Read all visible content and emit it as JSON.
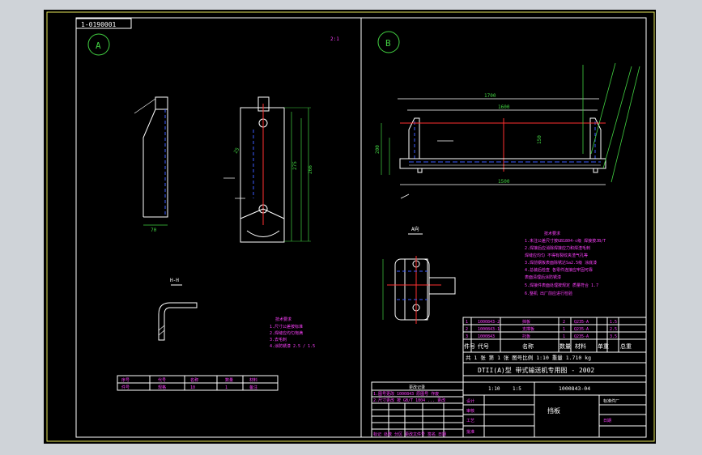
{
  "drawing": {
    "code_box": "1-0190001",
    "view_a_label": "A",
    "view_b_label": "B",
    "scale_note": "2:1",
    "section_label_h": "H-H",
    "section_label_a": "A向",
    "dim_a_width": "70",
    "dim_a_height": "275",
    "dim_a_height2": "266",
    "dim_a_small": "25",
    "dim_b_overall": "1700",
    "dim_b_inner": "1600",
    "dim_b_height": "200",
    "dim_b_mid": "150",
    "dim_b_bottom": "1500"
  },
  "tech_req_a": {
    "title": "技术要求",
    "lines": [
      "1.尺寸公差按标准",
      "2.焊缝应均匀饱满",
      "3.去毛刺",
      "4.涂防锈漆 2.5 / 1.5"
    ]
  },
  "tech_req_b": {
    "title": "技术要求",
    "lines": [
      "1.未注公差尺寸按GB1804-c级 焊接按JB/T",
      "2.焊接后应消除焊接应力和焊渣毛刺",
      "  焊缝应均匀 不得有裂纹夹渣气孔等",
      "3.焊前钢板表面除锈达Sa2.5级 涂底漆",
      "4.总装后检查 各零件连接应牢固可靠",
      "  表面清理后涂防锈漆",
      "5.焊接件表面处理按规定 质量符合 1.7",
      "6.整机 出厂前应进行检验"
    ]
  },
  "small_table": {
    "row1": [
      "序号",
      "代号",
      "名称",
      "数量",
      "材料"
    ],
    "row2": [
      "件号",
      "规格",
      "10",
      "1",
      "备注"
    ]
  },
  "bom": {
    "rows": [
      [
        "1",
        "1000843-2",
        "挡板",
        "2",
        "Q235-A",
        "",
        "1.5"
      ],
      [
        "2",
        "1000843-1",
        "支撑板",
        "1",
        "Q235-A",
        "",
        "2.5"
      ],
      [
        "3",
        "1000843",
        "托板",
        "1",
        "Q235-A",
        "",
        "3.5"
      ]
    ],
    "header": [
      "件号",
      "代号",
      "名称",
      "数量",
      "材料",
      "单重",
      "总重"
    ],
    "note_line": "共 1 张  第 1 张  图号比例 1:10  重量 1.710 kg"
  },
  "title_block": {
    "main_title": "DTII(A)型  带式输送机专用图 - 2002",
    "scale": "1:10",
    "ratio": "1:5",
    "drawing_no": "1000843-04",
    "part_name": "挡板",
    "company": "标准件厂",
    "date_fields": [
      "设计",
      "审核",
      "工艺",
      "批准",
      "日期"
    ]
  },
  "rev_table": {
    "title": "更改记录",
    "lines": [
      "1.图号更改 1000843 原图号 作废",
      "2.尺寸更改 按 GB/T 1804 ... 更改",
      "标记  处数  分区  更改文件号  签名  日期"
    ]
  }
}
